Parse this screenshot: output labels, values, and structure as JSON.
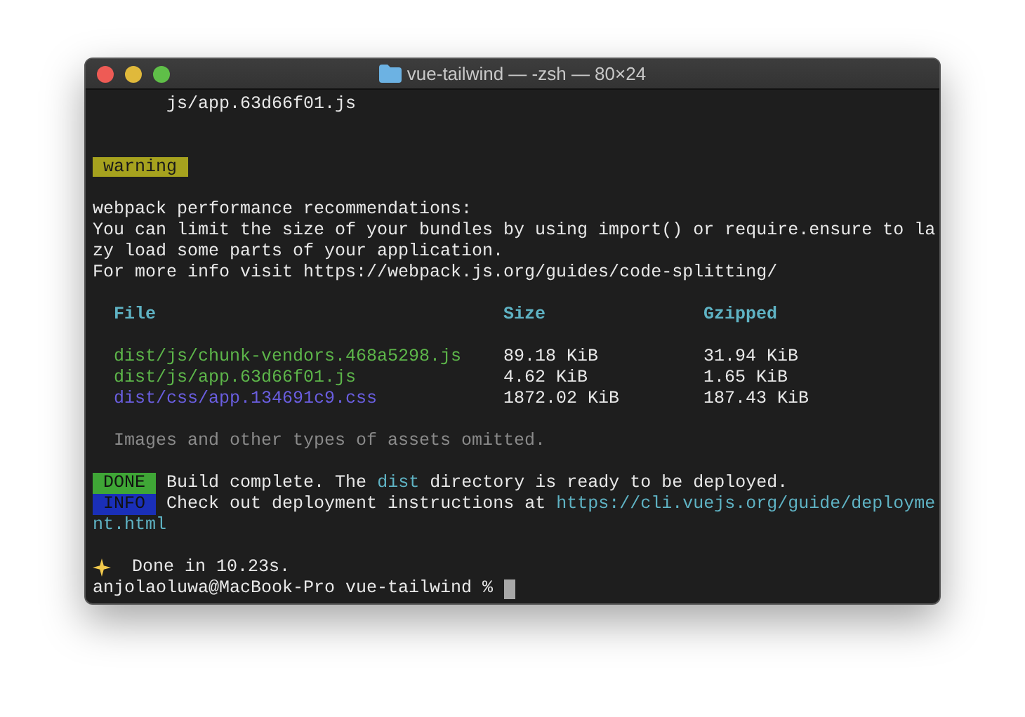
{
  "window": {
    "title": "vue-tailwind — -zsh — 80×24"
  },
  "terminal": {
    "output_path": "js/app.63d66f01.js",
    "warning": {
      "badge": "warning",
      "color": "#a6a21e"
    },
    "recommendations": [
      "webpack performance recommendations:",
      "You can limit the size of your bundles by using import() or require.ensure to la",
      "zy load some parts of your application.",
      "For more info visit https://webpack.js.org/guides/code-splitting/"
    ],
    "table": {
      "columns": [
        "File",
        "Size",
        "Gzipped"
      ],
      "rows": [
        {
          "kind": "js",
          "cells": [
            "dist/js/chunk-vendors.468a5298.js",
            "89.18 KiB",
            "31.94 KiB"
          ]
        },
        {
          "kind": "js",
          "cells": [
            "dist/js/app.63d66f01.js",
            "4.62 KiB",
            "1.65 KiB"
          ]
        },
        {
          "kind": "css",
          "cells": [
            "dist/css/app.134691c9.css",
            "1872.02 KiB",
            "187.43 KiB"
          ]
        }
      ]
    },
    "table_note": "Images and other types of assets omitted.",
    "messages": [
      {
        "badge": "DONE",
        "color": "#3fa636",
        "segments": [
          {
            "text": "Build complete. The ",
            "kind": "plain"
          },
          {
            "text": "dist",
            "kind": "highlight"
          },
          {
            "text": " directory is ready to be deployed.",
            "kind": "plain"
          }
        ]
      },
      {
        "badge": "INFO",
        "color": "#1a2fb8",
        "segments": [
          {
            "text": "Check out deployment instructions at ",
            "kind": "plain"
          },
          {
            "text": "https://cli.vuejs.org/guide/deployme",
            "kind": "link"
          }
        ],
        "continuation": "nt.html"
      }
    ],
    "done": "Done in 10.23s.",
    "prompt": "anjolaoluwa@MacBook-Pro vue-tailwind %"
  }
}
